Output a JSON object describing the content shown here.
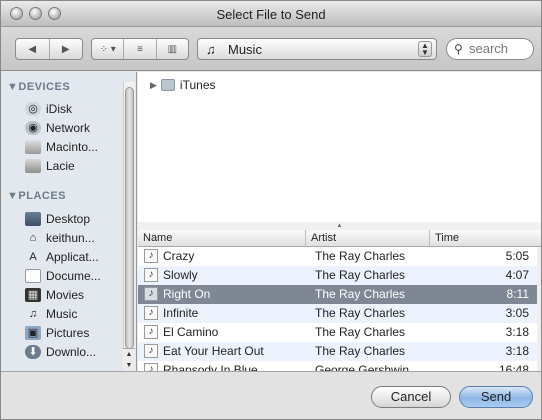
{
  "window": {
    "title": "Select File to Send"
  },
  "toolbar": {
    "nav_back": "◀",
    "nav_forward": "▶",
    "view_icon": "⁘ ▾",
    "view_list": "≡",
    "view_column": "▥",
    "location": "Music",
    "search_placeholder": "search"
  },
  "sidebar": {
    "devices_header": "▼DEVICES",
    "devices": [
      {
        "label": "iDisk",
        "icon": "idisk-icon"
      },
      {
        "label": "Network",
        "icon": "network-icon"
      },
      {
        "label": "Macinto...",
        "icon": "hard-disk-icon"
      },
      {
        "label": "Lacie",
        "icon": "external-disk-icon"
      }
    ],
    "places_header": "▼PLACES",
    "places": [
      {
        "label": "Desktop",
        "icon": "desktop-icon"
      },
      {
        "label": "keithun...",
        "icon": "home-icon"
      },
      {
        "label": "Applicat...",
        "icon": "applications-icon"
      },
      {
        "label": "Docume...",
        "icon": "documents-icon"
      },
      {
        "label": "Movies",
        "icon": "movies-icon"
      },
      {
        "label": "Music",
        "icon": "music-icon"
      },
      {
        "label": "Pictures",
        "icon": "pictures-icon"
      },
      {
        "label": "Downlo...",
        "icon": "downloads-icon"
      }
    ]
  },
  "browser": {
    "folder": "iTunes"
  },
  "table": {
    "columns": [
      "Name",
      "Artist",
      "Time"
    ],
    "rows": [
      {
        "name": "Crazy",
        "artist": "The Ray Charles",
        "time": "5:05"
      },
      {
        "name": "Slowly",
        "artist": "The Ray Charles",
        "time": "4:07"
      },
      {
        "name": "Right On",
        "artist": "The Ray Charles",
        "time": "8:11",
        "selected": true
      },
      {
        "name": "Infinite",
        "artist": "The Ray Charles",
        "time": "3:05"
      },
      {
        "name": "El Camino",
        "artist": "The Ray Charles",
        "time": "3:18"
      },
      {
        "name": "Eat Your Heart Out",
        "artist": "The Ray Charles",
        "time": "3:18"
      },
      {
        "name": "Rhapsody In Blue",
        "artist": "George Gershwin",
        "time": "16:48"
      }
    ]
  },
  "buttons": {
    "cancel": "Cancel",
    "send": "Send"
  }
}
